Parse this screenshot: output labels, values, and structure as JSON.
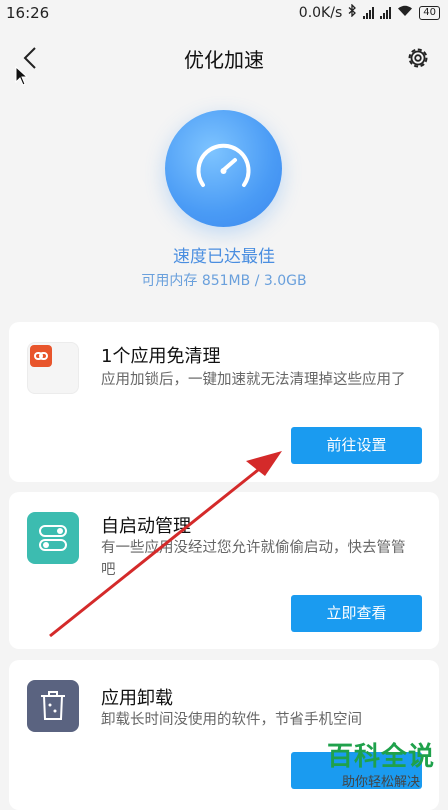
{
  "status_bar": {
    "time": "16:26",
    "network_speed": "0.0K/s",
    "battery": "40"
  },
  "header": {
    "title": "优化加速"
  },
  "speed": {
    "status": "速度已达最佳",
    "memory": "可用内存 851MB / 3.0GB"
  },
  "cards": [
    {
      "title": "1个应用免清理",
      "description": "应用加锁后，一键加速就无法清理掉这些应用了",
      "button": "前往设置",
      "icon": "app-lock-icon"
    },
    {
      "title": "自启动管理",
      "description": "有一些应用没经过您允许就偷偷启动，快去管管吧",
      "button": "立即查看",
      "icon": "autostart-toggle-icon"
    },
    {
      "title": "应用卸载",
      "description": "卸载长时间没使用的软件，节省手机空间",
      "icon": "uninstall-trash-icon"
    }
  ],
  "watermark": {
    "main": "百科全说",
    "sub": "助你轻松解决"
  },
  "colors": {
    "accent": "#1a9bf0",
    "gauge": "#4a9bf5",
    "card1_icon": "#e8552c",
    "card2_icon": "#3cbcb0",
    "card3_icon": "#5a6380",
    "annotation_arrow": "#d42a2a"
  }
}
